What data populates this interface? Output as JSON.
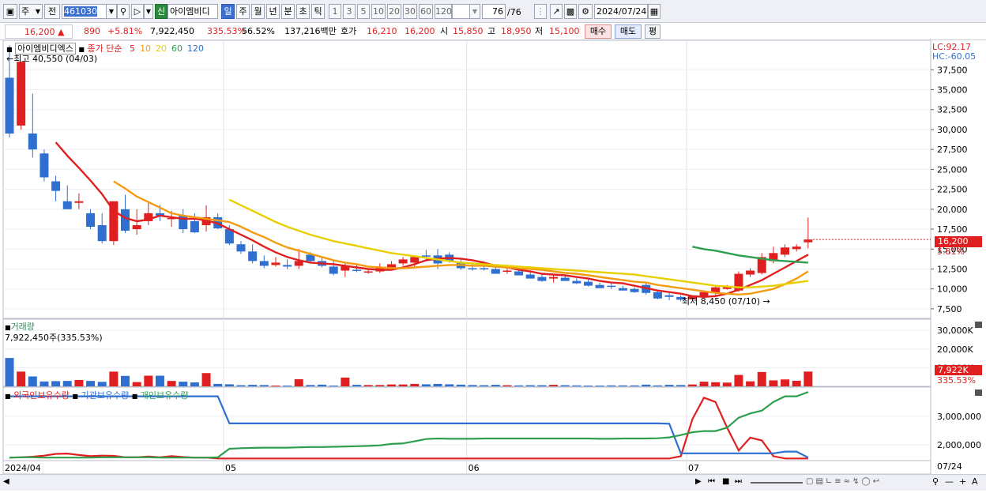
{
  "toolbar": {
    "period_type": "주",
    "prev_label": "전",
    "code": "461030",
    "trade_type": "신",
    "stock_name": "아이엠비디",
    "intervals": [
      "일",
      "주",
      "월",
      "년",
      "분",
      "초",
      "틱"
    ],
    "active_interval": 0,
    "minute_steps": [
      "1",
      "3",
      "5",
      "10",
      "20",
      "30",
      "60",
      "120"
    ],
    "count": "76",
    "count_total": "/76",
    "date": "2024/07/24"
  },
  "quote": {
    "price": "16,200",
    "change_arrow": "▲",
    "change": "890",
    "change_pct": "+5.81%",
    "volume": "7,922,450",
    "volume_ratio": "335.53%",
    "turnover_ratio": "56.52%",
    "amount": "137,216백만",
    "bid_ask_label": "호가",
    "bid_ask": "16,210",
    "bid2": "16,200",
    "open_label": "시",
    "open": "15,850",
    "high_label": "고",
    "high": "18,950",
    "low_label": "저",
    "low": "15,100",
    "buy_label": "매수",
    "sell_label": "매도",
    "avg_label": "평"
  },
  "price_panel": {
    "stock_name": "아이엠비디엑스",
    "ma_title": "종가 단순",
    "ma_periods": [
      "5",
      "10",
      "20",
      "60",
      "120"
    ],
    "ma_colors": [
      "#e02020",
      "#f39c12",
      "#e8d000",
      "#2e9e4f",
      "#2f6fbf"
    ],
    "high_label": "최고 40,550 (04/03)",
    "low_label": "최저 8,450 (07/10)",
    "lc": "LC:92.17",
    "hc": "HC:-60.05",
    "current_price_tag": "16,200",
    "current_pct_tag": "5.81%",
    "y_ticks": [
      "37,500",
      "35,000",
      "32,500",
      "30,000",
      "27,500",
      "25,000",
      "22,500",
      "20,000",
      "17,500",
      "15,000",
      "12,500",
      "10,000",
      "7,500"
    ]
  },
  "volume_panel": {
    "title": "거래량",
    "value_label": "7,922,450주(335.53%)",
    "y_ticks": [
      "30,000K",
      "20,000K",
      "10,000K"
    ],
    "last_tag": "7,922K",
    "last_pct": "335.53%"
  },
  "holdings_panel": {
    "series_names": [
      "외국인보유수량",
      "기관보유수량",
      "개인보유수량"
    ],
    "series_colors": [
      "#e02020",
      "#2f6fd0",
      "#2e9e4f"
    ],
    "y_ticks": [
      "3,000,000",
      "2,000,000"
    ]
  },
  "x_axis": {
    "labels": [
      "2024/04",
      "05",
      "06",
      "07"
    ],
    "right_label": "07/24"
  },
  "chart_data": {
    "type": "candlestick",
    "x_label_positions": [
      "2024/04",
      "05",
      "06",
      "07"
    ],
    "price": {
      "ylim": [
        6500,
        41000
      ],
      "candles": [
        [
          36500,
          40550,
          29000,
          29500
        ],
        [
          30500,
          38500,
          30000,
          38500
        ],
        [
          29500,
          34500,
          26500,
          27500
        ],
        [
          27000,
          27500,
          23500,
          24000
        ],
        [
          23500,
          24200,
          21000,
          22300
        ],
        [
          21000,
          23000,
          20500,
          20000
        ],
        [
          20800,
          22000,
          20000,
          21000
        ],
        [
          19500,
          20000,
          17500,
          17800
        ],
        [
          18000,
          19500,
          15700,
          16000
        ],
        [
          16000,
          21000,
          15500,
          21000
        ],
        [
          20000,
          21800,
          17000,
          17300
        ],
        [
          17500,
          20000,
          16800,
          18000
        ],
        [
          18500,
          21000,
          18000,
          19500
        ],
        [
          19500,
          20500,
          18500,
          19200
        ],
        [
          18900,
          19800,
          17800,
          18900
        ],
        [
          19200,
          20000,
          17000,
          17500
        ],
        [
          18500,
          19500,
          17000,
          17100
        ],
        [
          18000,
          20500,
          17200,
          19000
        ],
        [
          19000,
          19500,
          17500,
          17600
        ],
        [
          17500,
          18000,
          15500,
          15700
        ],
        [
          15600,
          16000,
          14400,
          14700
        ],
        [
          14700,
          15600,
          13200,
          13500
        ],
        [
          13500,
          14200,
          12600,
          12900
        ],
        [
          13000,
          14000,
          12800,
          13300
        ],
        [
          13000,
          13700,
          12500,
          12800
        ],
        [
          12900,
          15000,
          12500,
          13500
        ],
        [
          14300,
          14600,
          13300,
          13500
        ],
        [
          13500,
          14000,
          12700,
          12900
        ],
        [
          12800,
          13500,
          11700,
          11900
        ],
        [
          12300,
          13300,
          11500,
          12900
        ],
        [
          12400,
          13000,
          12100,
          12300
        ],
        [
          12100,
          12600,
          11900,
          12200
        ],
        [
          12200,
          13200,
          12000,
          12700
        ],
        [
          12600,
          13500,
          12300,
          13100
        ],
        [
          13200,
          14000,
          12900,
          13700
        ],
        [
          13300,
          14200,
          12800,
          14000
        ],
        [
          14200,
          14900,
          13500,
          14100
        ],
        [
          14200,
          15000,
          12500,
          13200
        ],
        [
          14300,
          14600,
          13300,
          13500
        ],
        [
          13400,
          13700,
          12400,
          12600
        ],
        [
          12600,
          13200,
          12300,
          12500
        ],
        [
          12600,
          13000,
          12300,
          12500
        ],
        [
          12500,
          13000,
          11900,
          11900
        ],
        [
          12200,
          12600,
          11900,
          12300
        ],
        [
          12200,
          12500,
          11700,
          11700
        ],
        [
          11800,
          12200,
          11300,
          11300
        ],
        [
          11500,
          12000,
          10900,
          11000
        ],
        [
          11300,
          11900,
          10800,
          11500
        ],
        [
          11400,
          11700,
          11000,
          11000
        ],
        [
          11000,
          11400,
          10600,
          10700
        ],
        [
          10900,
          11300,
          10300,
          10400
        ],
        [
          10500,
          10800,
          10100,
          10100
        ],
        [
          10400,
          10700,
          10000,
          10300
        ],
        [
          10100,
          10400,
          9800,
          9800
        ],
        [
          10000,
          10200,
          9500,
          9600
        ],
        [
          10500,
          10800,
          9300,
          9500
        ],
        [
          9600,
          9800,
          8700,
          8800
        ],
        [
          9200,
          9500,
          8600,
          9000
        ],
        [
          9000,
          9200,
          8450,
          8650
        ],
        [
          8700,
          9100,
          8500,
          9100
        ],
        [
          9100,
          9800,
          8900,
          9600
        ],
        [
          9500,
          10300,
          9200,
          10200
        ],
        [
          10000,
          10500,
          9900,
          10300
        ],
        [
          9800,
          12200,
          9600,
          11900
        ],
        [
          11800,
          12600,
          11500,
          12300
        ],
        [
          12000,
          14500,
          11800,
          14000
        ],
        [
          13500,
          15300,
          13200,
          14500
        ],
        [
          14300,
          15600,
          14000,
          15200
        ],
        [
          15000,
          15600,
          14700,
          15310
        ],
        [
          15850,
          18950,
          15100,
          16200
        ]
      ],
      "ma5": [
        null,
        null,
        null,
        null,
        28400,
        26700,
        25200,
        23600,
        21900,
        19800,
        18900,
        18500,
        18700,
        19200,
        19000,
        18800,
        18800,
        18600,
        18200,
        17500,
        16800,
        16100,
        15300,
        14600,
        14000,
        13600,
        13300,
        13200,
        13100,
        12900,
        12700,
        12500,
        12400,
        12400,
        12700,
        13100,
        13600,
        13800,
        13900,
        13800,
        13600,
        13300,
        12900,
        12700,
        12400,
        12200,
        11900,
        11800,
        11700,
        11500,
        11300,
        11000,
        10800,
        10700,
        10400,
        10100,
        9800,
        9600,
        9400,
        9100,
        9000,
        9100,
        9400,
        9900,
        10500,
        11100,
        11900,
        12700,
        13500,
        14300
      ],
      "ma10": [
        null,
        null,
        null,
        null,
        null,
        null,
        null,
        null,
        null,
        23500,
        22600,
        21600,
        20900,
        20200,
        19500,
        19200,
        19000,
        18800,
        18600,
        18400,
        17800,
        17100,
        16500,
        15800,
        15200,
        14800,
        14400,
        14000,
        13600,
        13300,
        13100,
        12800,
        12700,
        12600,
        12600,
        12700,
        12800,
        12900,
        13000,
        13000,
        12900,
        12900,
        12800,
        12700,
        12600,
        12500,
        12400,
        12200,
        12000,
        11900,
        11700,
        11500,
        11300,
        11100,
        10900,
        10800,
        10500,
        10300,
        10100,
        9900,
        9700,
        9500,
        9400,
        9300,
        9400,
        9700,
        10000,
        10600,
        11300,
        12200
      ],
      "ma20": [
        null,
        null,
        null,
        null,
        null,
        null,
        null,
        null,
        null,
        null,
        null,
        null,
        null,
        null,
        null,
        null,
        null,
        null,
        null,
        21200,
        20500,
        19800,
        19100,
        18400,
        17800,
        17300,
        16800,
        16400,
        16000,
        15700,
        15400,
        15100,
        14800,
        14500,
        14300,
        14100,
        13900,
        13700,
        13500,
        13300,
        13200,
        13100,
        13000,
        12900,
        12800,
        12700,
        12600,
        12500,
        12400,
        12300,
        12200,
        12100,
        12000,
        11900,
        11800,
        11600,
        11400,
        11200,
        11000,
        10800,
        10600,
        10400,
        10300,
        10200,
        10200,
        10300,
        10400,
        10600,
        10800,
        11000
      ],
      "ma60": [
        null,
        null,
        null,
        null,
        null,
        null,
        null,
        null,
        null,
        null,
        null,
        null,
        null,
        null,
        null,
        null,
        null,
        null,
        null,
        null,
        null,
        null,
        null,
        null,
        null,
        null,
        null,
        null,
        null,
        null,
        null,
        null,
        null,
        null,
        null,
        null,
        null,
        null,
        null,
        null,
        null,
        null,
        null,
        null,
        null,
        null,
        null,
        null,
        null,
        null,
        null,
        null,
        null,
        null,
        null,
        null,
        null,
        null,
        null,
        15300,
        15000,
        14800,
        14500,
        14200,
        14000,
        13800,
        13600,
        13500,
        13400,
        13300
      ]
    },
    "volume_k": [
      15200,
      7900,
      5300,
      2600,
      2800,
      2900,
      3400,
      2900,
      2400,
      7900,
      5600,
      2300,
      5700,
      5700,
      2900,
      2500,
      2100,
      7100,
      1300,
      1100,
      600,
      800,
      700,
      400,
      400,
      3800,
      700,
      900,
      400,
      4700,
      800,
      700,
      700,
      1000,
      1000,
      1300,
      1100,
      1300,
      1100,
      900,
      700,
      600,
      800,
      600,
      500,
      600,
      600,
      800,
      600,
      500,
      400,
      400,
      500,
      500,
      500,
      900,
      500,
      800,
      700,
      1000,
      2500,
      2200,
      2000,
      6100,
      2700,
      7700,
      3200,
      3700,
      3000,
      7922
    ],
    "volume_ylim": [
      0,
      36000
    ],
    "holdings": {
      "ylim": [
        1500000,
        3800000
      ],
      "foreign": [
        1550000,
        1560000,
        1580000,
        1620000,
        1680000,
        1690000,
        1640000,
        1600000,
        1620000,
        1610000,
        1560000,
        1560000,
        1590000,
        1560000,
        1600000,
        1570000,
        1550000,
        1550000,
        1520000,
        1520000,
        1520000,
        1520000,
        1520000,
        1520000,
        1520000,
        1520000,
        1520000,
        1520000,
        1520000,
        1520000,
        1520000,
        1520000,
        1520000,
        1520000,
        1520000,
        1520000,
        1520000,
        1520000,
        1520000,
        1520000,
        1520000,
        1520000,
        1520000,
        1520000,
        1520000,
        1520000,
        1520000,
        1520000,
        1520000,
        1520000,
        1520000,
        1520000,
        1520000,
        1520000,
        1520000,
        1520000,
        1520000,
        1520000,
        1600000,
        2900000,
        3650000,
        3500000,
        2600000,
        1800000,
        2250000,
        2150000,
        1600000,
        1520000,
        1520000,
        1520000
      ],
      "institution": [
        3700000,
        3700000,
        3700000,
        3700000,
        3700000,
        3700000,
        3700000,
        3700000,
        3700000,
        3700000,
        3700000,
        3700000,
        3700000,
        3700000,
        3700000,
        3700000,
        3700000,
        3700000,
        3700000,
        2750000,
        2750000,
        2750000,
        2750000,
        2750000,
        2750000,
        2750000,
        2750000,
        2750000,
        2750000,
        2750000,
        2750000,
        2750000,
        2750000,
        2750000,
        2750000,
        2750000,
        2750000,
        2750000,
        2750000,
        2750000,
        2750000,
        2750000,
        2750000,
        2750000,
        2750000,
        2750000,
        2750000,
        2750000,
        2750000,
        2750000,
        2750000,
        2750000,
        2750000,
        2750000,
        2750000,
        2750000,
        2750000,
        2740000,
        1700000,
        1700000,
        1700000,
        1700000,
        1700000,
        1700000,
        1700000,
        1700000,
        1700000,
        1760000,
        1760000,
        1550000
      ],
      "individual": [
        1550000,
        1560000,
        1560000,
        1550000,
        1550000,
        1550000,
        1550000,
        1550000,
        1560000,
        1560000,
        1560000,
        1560000,
        1560000,
        1550000,
        1550000,
        1550000,
        1550000,
        1550000,
        1560000,
        1860000,
        1880000,
        1890000,
        1900000,
        1900000,
        1900000,
        1910000,
        1920000,
        1920000,
        1930000,
        1940000,
        1950000,
        1960000,
        1980000,
        2030000,
        2050000,
        2120000,
        2200000,
        2220000,
        2210000,
        2210000,
        2210000,
        2220000,
        2220000,
        2220000,
        2220000,
        2220000,
        2220000,
        2220000,
        2220000,
        2220000,
        2220000,
        2210000,
        2210000,
        2220000,
        2220000,
        2220000,
        2230000,
        2260000,
        2340000,
        2440000,
        2480000,
        2480000,
        2600000,
        2950000,
        3100000,
        3200000,
        3500000,
        3700000,
        3700000,
        3850000
      ]
    }
  }
}
